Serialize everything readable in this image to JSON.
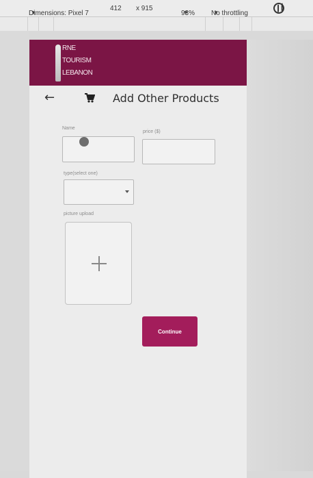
{
  "devtools": {
    "dimensions_label": "Dimensions: Pixel 7",
    "width": "412",
    "height": "x 915",
    "zoom": "93%",
    "throttling": "No throttling",
    "caret": "▼"
  },
  "app": {
    "logo_lines": [
      "RNE",
      "TOURISM",
      "LEBANON"
    ]
  },
  "page": {
    "title": "Add Other Products",
    "back_icon": "←"
  },
  "form": {
    "name_label": "Name",
    "price_label": "price ($)",
    "type_label": "type(select one)",
    "picture_label": "picture upload",
    "continue_label": "Continue"
  },
  "colors": {
    "header": "#7b1545",
    "button": "#a31d5b"
  }
}
